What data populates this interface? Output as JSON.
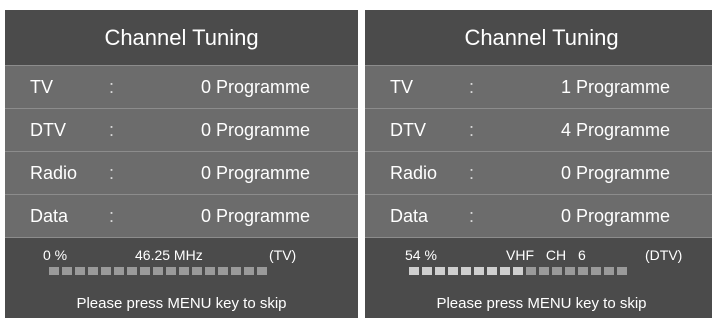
{
  "panels": [
    {
      "title": "Channel Tuning",
      "rows": [
        {
          "label": "TV",
          "sep": ":",
          "value": "0 Programme"
        },
        {
          "label": "DTV",
          "sep": ":",
          "value": "0 Programme"
        },
        {
          "label": "Radio",
          "sep": ":",
          "value": "0 Programme"
        },
        {
          "label": "Data",
          "sep": ":",
          "value": "0 Programme"
        }
      ],
      "status": {
        "percent": "0 %",
        "frequency": "46.25 MHz",
        "mode": "(TV)"
      },
      "progress": {
        "segments": 17,
        "filled_fraction": 0.0
      },
      "hint": "Please press MENU key to skip"
    },
    {
      "title": "Channel Tuning",
      "rows": [
        {
          "label": "TV",
          "sep": ":",
          "value": "1 Programme"
        },
        {
          "label": "DTV",
          "sep": ":",
          "value": "4 Programme"
        },
        {
          "label": "Radio",
          "sep": ":",
          "value": "0 Programme"
        },
        {
          "label": "Data",
          "sep": ":",
          "value": "0 Programme"
        }
      ],
      "status": {
        "percent": "54 %",
        "frequency": "VHF CH 6",
        "mode": "(DTV)"
      },
      "progress": {
        "segments": 17,
        "filled_fraction": 0.54
      },
      "hint": "Please press MENU key to skip"
    }
  ],
  "colors": {
    "panel_bg": "#4b4b4b",
    "row_bg": "#6c6c6c",
    "row_divider": "#8c8c8c",
    "progress_empty": "#9a9a9a",
    "progress_filled": "#cfcfcf",
    "text": "#ffffff"
  }
}
